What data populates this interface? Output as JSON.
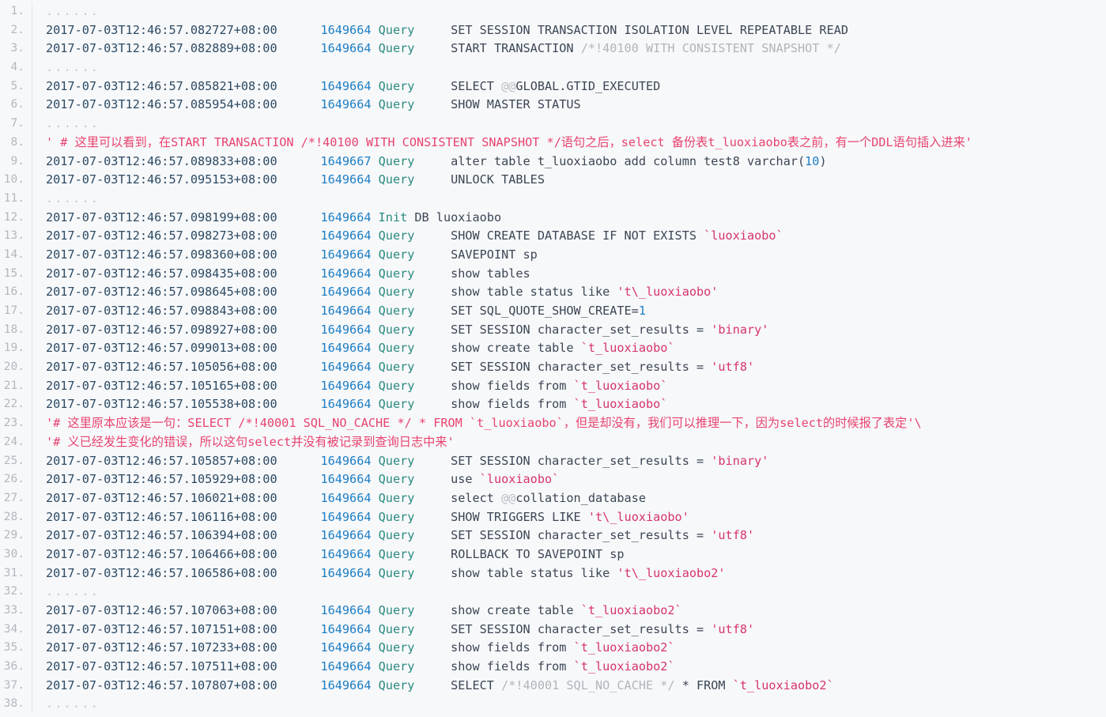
{
  "viewer": {
    "kind": "code-block",
    "language": "mysql-general-log",
    "total_lines": 38,
    "line_number_suffix": ".",
    "colors": {
      "background": "#f7f8fa",
      "gutter_text": "#b3b8bf",
      "gutter_divider": "#e1e4e8",
      "timestamp": "#2c4a63",
      "number": "#1d7ec4",
      "command": "#2a8a80",
      "plain": "#3b4654",
      "string": "#d6336c",
      "comment": "#b0b5bb",
      "annotation": "#e8436f",
      "ellipsis": "#c3c8ce"
    }
  },
  "lines": [
    {
      "n": "1.",
      "tokens": [
        {
          "t": "......",
          "c": "ellipsis"
        }
      ]
    },
    {
      "n": "2.",
      "tokens": [
        {
          "t": "2017-07-03T12:46:57.082727+08:00",
          "c": "ts"
        },
        {
          "t": "      ",
          "c": "plain"
        },
        {
          "t": "1649664",
          "c": "num"
        },
        {
          "t": " ",
          "c": "plain"
        },
        {
          "t": "Query",
          "c": "cmd"
        },
        {
          "t": "     SET SESSION TRANSACTION ISOLATION LEVEL REPEATABLE READ",
          "c": "plain"
        }
      ]
    },
    {
      "n": "3.",
      "tokens": [
        {
          "t": "2017-07-03T12:46:57.082889+08:00",
          "c": "ts"
        },
        {
          "t": "      ",
          "c": "plain"
        },
        {
          "t": "1649664",
          "c": "num"
        },
        {
          "t": " ",
          "c": "plain"
        },
        {
          "t": "Query",
          "c": "cmd"
        },
        {
          "t": "     START TRANSACTION ",
          "c": "plain"
        },
        {
          "t": "/*!40100 WITH CONSISTENT SNAPSHOT */",
          "c": "comment"
        }
      ]
    },
    {
      "n": "4.",
      "tokens": [
        {
          "t": "......",
          "c": "ellipsis"
        }
      ]
    },
    {
      "n": "5.",
      "tokens": [
        {
          "t": "2017-07-03T12:46:57.085821+08:00",
          "c": "ts"
        },
        {
          "t": "      ",
          "c": "plain"
        },
        {
          "t": "1649664",
          "c": "num"
        },
        {
          "t": " ",
          "c": "plain"
        },
        {
          "t": "Query",
          "c": "cmd"
        },
        {
          "t": "     SELECT ",
          "c": "plain"
        },
        {
          "t": "@@",
          "c": "at"
        },
        {
          "t": "GLOBAL.GTID_EXECUTED",
          "c": "plain"
        }
      ]
    },
    {
      "n": "6.",
      "tokens": [
        {
          "t": "2017-07-03T12:46:57.085954+08:00",
          "c": "ts"
        },
        {
          "t": "      ",
          "c": "plain"
        },
        {
          "t": "1649664",
          "c": "num"
        },
        {
          "t": " ",
          "c": "plain"
        },
        {
          "t": "Query",
          "c": "cmd"
        },
        {
          "t": "     SHOW MASTER STATUS",
          "c": "plain"
        }
      ]
    },
    {
      "n": "7.",
      "tokens": [
        {
          "t": "......",
          "c": "ellipsis"
        }
      ]
    },
    {
      "n": "8.",
      "tokens": [
        {
          "t": "' # 这里可以看到，在START TRANSACTION /*!40100 WITH CONSISTENT SNAPSHOT */语句之后，select 备份表t_luoxiaobo表之前，有一个DDL语句插入进来'",
          "c": "note"
        }
      ]
    },
    {
      "n": "9.",
      "tokens": [
        {
          "t": "2017-07-03T12:46:57.089833+08:00",
          "c": "ts"
        },
        {
          "t": "      ",
          "c": "plain"
        },
        {
          "t": "1649667",
          "c": "num"
        },
        {
          "t": " ",
          "c": "plain"
        },
        {
          "t": "Query",
          "c": "cmd"
        },
        {
          "t": "     alter table t_luoxiaobo add column test8 varchar(",
          "c": "plain"
        },
        {
          "t": "10",
          "c": "num"
        },
        {
          "t": ")",
          "c": "plain"
        }
      ]
    },
    {
      "n": "10.",
      "tokens": [
        {
          "t": "2017-07-03T12:46:57.095153+08:00",
          "c": "ts"
        },
        {
          "t": "      ",
          "c": "plain"
        },
        {
          "t": "1649664",
          "c": "num"
        },
        {
          "t": " ",
          "c": "plain"
        },
        {
          "t": "Query",
          "c": "cmd"
        },
        {
          "t": "     UNLOCK TABLES",
          "c": "plain"
        }
      ]
    },
    {
      "n": "11.",
      "tokens": [
        {
          "t": "......",
          "c": "ellipsis"
        }
      ]
    },
    {
      "n": "12.",
      "tokens": [
        {
          "t": "2017-07-03T12:46:57.098199+08:00",
          "c": "ts"
        },
        {
          "t": "      ",
          "c": "plain"
        },
        {
          "t": "1649664",
          "c": "num"
        },
        {
          "t": " ",
          "c": "plain"
        },
        {
          "t": "Init",
          "c": "cmd"
        },
        {
          "t": " DB luoxiaobo",
          "c": "plain"
        }
      ]
    },
    {
      "n": "13.",
      "tokens": [
        {
          "t": "2017-07-03T12:46:57.098273+08:00",
          "c": "ts"
        },
        {
          "t": "      ",
          "c": "plain"
        },
        {
          "t": "1649664",
          "c": "num"
        },
        {
          "t": " ",
          "c": "plain"
        },
        {
          "t": "Query",
          "c": "cmd"
        },
        {
          "t": "     SHOW CREATE DATABASE IF NOT EXISTS ",
          "c": "plain"
        },
        {
          "t": "`luoxiaobo`",
          "c": "str"
        }
      ]
    },
    {
      "n": "14.",
      "tokens": [
        {
          "t": "2017-07-03T12:46:57.098360+08:00",
          "c": "ts"
        },
        {
          "t": "      ",
          "c": "plain"
        },
        {
          "t": "1649664",
          "c": "num"
        },
        {
          "t": " ",
          "c": "plain"
        },
        {
          "t": "Query",
          "c": "cmd"
        },
        {
          "t": "     SAVEPOINT sp",
          "c": "plain"
        }
      ]
    },
    {
      "n": "15.",
      "tokens": [
        {
          "t": "2017-07-03T12:46:57.098435+08:00",
          "c": "ts"
        },
        {
          "t": "      ",
          "c": "plain"
        },
        {
          "t": "1649664",
          "c": "num"
        },
        {
          "t": " ",
          "c": "plain"
        },
        {
          "t": "Query",
          "c": "cmd"
        },
        {
          "t": "     show tables",
          "c": "plain"
        }
      ]
    },
    {
      "n": "16.",
      "tokens": [
        {
          "t": "2017-07-03T12:46:57.098645+08:00",
          "c": "ts"
        },
        {
          "t": "      ",
          "c": "plain"
        },
        {
          "t": "1649664",
          "c": "num"
        },
        {
          "t": " ",
          "c": "plain"
        },
        {
          "t": "Query",
          "c": "cmd"
        },
        {
          "t": "     show table status like ",
          "c": "plain"
        },
        {
          "t": "'t\\_luoxiaobo'",
          "c": "str"
        }
      ]
    },
    {
      "n": "17.",
      "tokens": [
        {
          "t": "2017-07-03T12:46:57.098843+08:00",
          "c": "ts"
        },
        {
          "t": "      ",
          "c": "plain"
        },
        {
          "t": "1649664",
          "c": "num"
        },
        {
          "t": " ",
          "c": "plain"
        },
        {
          "t": "Query",
          "c": "cmd"
        },
        {
          "t": "     SET SQL_QUOTE_SHOW_CREATE=",
          "c": "plain"
        },
        {
          "t": "1",
          "c": "num"
        }
      ]
    },
    {
      "n": "18.",
      "tokens": [
        {
          "t": "2017-07-03T12:46:57.098927+08:00",
          "c": "ts"
        },
        {
          "t": "      ",
          "c": "plain"
        },
        {
          "t": "1649664",
          "c": "num"
        },
        {
          "t": " ",
          "c": "plain"
        },
        {
          "t": "Query",
          "c": "cmd"
        },
        {
          "t": "     SET SESSION character_set_results = ",
          "c": "plain"
        },
        {
          "t": "'binary'",
          "c": "str"
        }
      ]
    },
    {
      "n": "19.",
      "tokens": [
        {
          "t": "2017-07-03T12:46:57.099013+08:00",
          "c": "ts"
        },
        {
          "t": "      ",
          "c": "plain"
        },
        {
          "t": "1649664",
          "c": "num"
        },
        {
          "t": " ",
          "c": "plain"
        },
        {
          "t": "Query",
          "c": "cmd"
        },
        {
          "t": "     show create table ",
          "c": "plain"
        },
        {
          "t": "`t_luoxiaobo`",
          "c": "str"
        }
      ]
    },
    {
      "n": "20.",
      "tokens": [
        {
          "t": "2017-07-03T12:46:57.105056+08:00",
          "c": "ts"
        },
        {
          "t": "      ",
          "c": "plain"
        },
        {
          "t": "1649664",
          "c": "num"
        },
        {
          "t": " ",
          "c": "plain"
        },
        {
          "t": "Query",
          "c": "cmd"
        },
        {
          "t": "     SET SESSION character_set_results = ",
          "c": "plain"
        },
        {
          "t": "'utf8'",
          "c": "str"
        }
      ]
    },
    {
      "n": "21.",
      "tokens": [
        {
          "t": "2017-07-03T12:46:57.105165+08:00",
          "c": "ts"
        },
        {
          "t": "      ",
          "c": "plain"
        },
        {
          "t": "1649664",
          "c": "num"
        },
        {
          "t": " ",
          "c": "plain"
        },
        {
          "t": "Query",
          "c": "cmd"
        },
        {
          "t": "     show fields from ",
          "c": "plain"
        },
        {
          "t": "`t_luoxiaobo`",
          "c": "str"
        }
      ]
    },
    {
      "n": "22.",
      "tokens": [
        {
          "t": "2017-07-03T12:46:57.105538+08:00",
          "c": "ts"
        },
        {
          "t": "      ",
          "c": "plain"
        },
        {
          "t": "1649664",
          "c": "num"
        },
        {
          "t": " ",
          "c": "plain"
        },
        {
          "t": "Query",
          "c": "cmd"
        },
        {
          "t": "     show fields from ",
          "c": "plain"
        },
        {
          "t": "`t_luoxiaobo`",
          "c": "str"
        }
      ]
    },
    {
      "n": "23.",
      "tokens": [
        {
          "t": "'# 这里原本应该是一句：SELECT /*!40001 SQL_NO_CACHE */ * FROM `t_luoxiaobo`，但是却没有，我们可以推理一下，因为select的时候报了表定'\\",
          "c": "note"
        }
      ]
    },
    {
      "n": "24.",
      "tokens": [
        {
          "t": "'# 义已经发生变化的错误，所以这句select并没有被记录到查询日志中来'",
          "c": "note"
        }
      ]
    },
    {
      "n": "25.",
      "tokens": [
        {
          "t": "2017-07-03T12:46:57.105857+08:00",
          "c": "ts"
        },
        {
          "t": "      ",
          "c": "plain"
        },
        {
          "t": "1649664",
          "c": "num"
        },
        {
          "t": " ",
          "c": "plain"
        },
        {
          "t": "Query",
          "c": "cmd"
        },
        {
          "t": "     SET SESSION character_set_results = ",
          "c": "plain"
        },
        {
          "t": "'binary'",
          "c": "str"
        }
      ]
    },
    {
      "n": "26.",
      "tokens": [
        {
          "t": "2017-07-03T12:46:57.105929+08:00",
          "c": "ts"
        },
        {
          "t": "      ",
          "c": "plain"
        },
        {
          "t": "1649664",
          "c": "num"
        },
        {
          "t": " ",
          "c": "plain"
        },
        {
          "t": "Query",
          "c": "cmd"
        },
        {
          "t": "     use ",
          "c": "plain"
        },
        {
          "t": "`luoxiaobo`",
          "c": "str"
        }
      ]
    },
    {
      "n": "27.",
      "tokens": [
        {
          "t": "2017-07-03T12:46:57.106021+08:00",
          "c": "ts"
        },
        {
          "t": "      ",
          "c": "plain"
        },
        {
          "t": "1649664",
          "c": "num"
        },
        {
          "t": " ",
          "c": "plain"
        },
        {
          "t": "Query",
          "c": "cmd"
        },
        {
          "t": "     select ",
          "c": "plain"
        },
        {
          "t": "@@",
          "c": "at"
        },
        {
          "t": "collation_database",
          "c": "plain"
        }
      ]
    },
    {
      "n": "28.",
      "tokens": [
        {
          "t": "2017-07-03T12:46:57.106116+08:00",
          "c": "ts"
        },
        {
          "t": "      ",
          "c": "plain"
        },
        {
          "t": "1649664",
          "c": "num"
        },
        {
          "t": " ",
          "c": "plain"
        },
        {
          "t": "Query",
          "c": "cmd"
        },
        {
          "t": "     SHOW TRIGGERS LIKE ",
          "c": "plain"
        },
        {
          "t": "'t\\_luoxiaobo'",
          "c": "str"
        }
      ]
    },
    {
      "n": "29.",
      "tokens": [
        {
          "t": "2017-07-03T12:46:57.106394+08:00",
          "c": "ts"
        },
        {
          "t": "      ",
          "c": "plain"
        },
        {
          "t": "1649664",
          "c": "num"
        },
        {
          "t": " ",
          "c": "plain"
        },
        {
          "t": "Query",
          "c": "cmd"
        },
        {
          "t": "     SET SESSION character_set_results = ",
          "c": "plain"
        },
        {
          "t": "'utf8'",
          "c": "str"
        }
      ]
    },
    {
      "n": "30.",
      "tokens": [
        {
          "t": "2017-07-03T12:46:57.106466+08:00",
          "c": "ts"
        },
        {
          "t": "      ",
          "c": "plain"
        },
        {
          "t": "1649664",
          "c": "num"
        },
        {
          "t": " ",
          "c": "plain"
        },
        {
          "t": "Query",
          "c": "cmd"
        },
        {
          "t": "     ROLLBACK TO SAVEPOINT sp",
          "c": "plain"
        }
      ]
    },
    {
      "n": "31.",
      "tokens": [
        {
          "t": "2017-07-03T12:46:57.106586+08:00",
          "c": "ts"
        },
        {
          "t": "      ",
          "c": "plain"
        },
        {
          "t": "1649664",
          "c": "num"
        },
        {
          "t": " ",
          "c": "plain"
        },
        {
          "t": "Query",
          "c": "cmd"
        },
        {
          "t": "     show table status like ",
          "c": "plain"
        },
        {
          "t": "'t\\_luoxiaobo2'",
          "c": "str"
        }
      ]
    },
    {
      "n": "32.",
      "tokens": [
        {
          "t": "......",
          "c": "ellipsis"
        }
      ]
    },
    {
      "n": "33.",
      "tokens": [
        {
          "t": "2017-07-03T12:46:57.107063+08:00",
          "c": "ts"
        },
        {
          "t": "      ",
          "c": "plain"
        },
        {
          "t": "1649664",
          "c": "num"
        },
        {
          "t": " ",
          "c": "plain"
        },
        {
          "t": "Query",
          "c": "cmd"
        },
        {
          "t": "     show create table ",
          "c": "plain"
        },
        {
          "t": "`t_luoxiaobo2`",
          "c": "str"
        }
      ]
    },
    {
      "n": "34.",
      "tokens": [
        {
          "t": "2017-07-03T12:46:57.107151+08:00",
          "c": "ts"
        },
        {
          "t": "      ",
          "c": "plain"
        },
        {
          "t": "1649664",
          "c": "num"
        },
        {
          "t": " ",
          "c": "plain"
        },
        {
          "t": "Query",
          "c": "cmd"
        },
        {
          "t": "     SET SESSION character_set_results = ",
          "c": "plain"
        },
        {
          "t": "'utf8'",
          "c": "str"
        }
      ]
    },
    {
      "n": "35.",
      "tokens": [
        {
          "t": "2017-07-03T12:46:57.107233+08:00",
          "c": "ts"
        },
        {
          "t": "      ",
          "c": "plain"
        },
        {
          "t": "1649664",
          "c": "num"
        },
        {
          "t": " ",
          "c": "plain"
        },
        {
          "t": "Query",
          "c": "cmd"
        },
        {
          "t": "     show fields from ",
          "c": "plain"
        },
        {
          "t": "`t_luoxiaobo2`",
          "c": "str"
        }
      ]
    },
    {
      "n": "36.",
      "tokens": [
        {
          "t": "2017-07-03T12:46:57.107511+08:00",
          "c": "ts"
        },
        {
          "t": "      ",
          "c": "plain"
        },
        {
          "t": "1649664",
          "c": "num"
        },
        {
          "t": " ",
          "c": "plain"
        },
        {
          "t": "Query",
          "c": "cmd"
        },
        {
          "t": "     show fields from ",
          "c": "plain"
        },
        {
          "t": "`t_luoxiaobo2`",
          "c": "str"
        }
      ]
    },
    {
      "n": "37.",
      "tokens": [
        {
          "t": "2017-07-03T12:46:57.107807+08:00",
          "c": "ts"
        },
        {
          "t": "      ",
          "c": "plain"
        },
        {
          "t": "1649664",
          "c": "num"
        },
        {
          "t": " ",
          "c": "plain"
        },
        {
          "t": "Query",
          "c": "cmd"
        },
        {
          "t": "     SELECT ",
          "c": "plain"
        },
        {
          "t": "/*!40001 SQL_NO_CACHE */",
          "c": "comment"
        },
        {
          "t": " * FROM ",
          "c": "plain"
        },
        {
          "t": "`t_luoxiaobo2`",
          "c": "str"
        }
      ]
    },
    {
      "n": "38.",
      "tokens": [
        {
          "t": "......",
          "c": "ellipsis"
        }
      ]
    }
  ]
}
